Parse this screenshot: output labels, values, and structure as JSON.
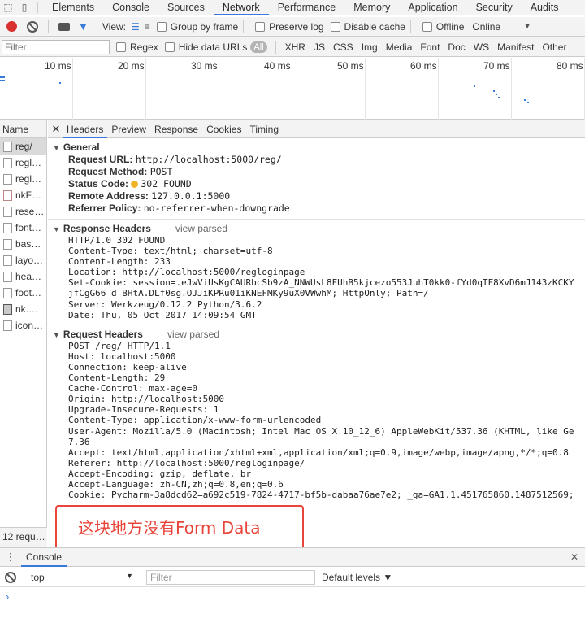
{
  "main_tabs": [
    "Elements",
    "Console",
    "Sources",
    "Network",
    "Performance",
    "Memory",
    "Application",
    "Security",
    "Audits"
  ],
  "active_tab": "Network",
  "toolbar": {
    "view_label": "View:",
    "group_by_frame": "Group by frame",
    "preserve_log": "Preserve log",
    "disable_cache": "Disable cache",
    "offline": "Offline",
    "throttle": "Online"
  },
  "filter": {
    "placeholder": "Filter",
    "regex": "Regex",
    "hide_data_urls": "Hide data URLs",
    "all": "All",
    "types": [
      "XHR",
      "JS",
      "CSS",
      "Img",
      "Media",
      "Font",
      "Doc",
      "WS",
      "Manifest",
      "Other"
    ]
  },
  "timeline_ticks": [
    "10 ms",
    "20 ms",
    "30 ms",
    "40 ms",
    "50 ms",
    "60 ms",
    "70 ms",
    "80 ms"
  ],
  "name_column": {
    "header": "Name",
    "items": [
      {
        "name": "reg/",
        "kind": "doc"
      },
      {
        "name": "regl…",
        "kind": "doc"
      },
      {
        "name": "regl…",
        "kind": "doc"
      },
      {
        "name": "nkF…",
        "kind": "font"
      },
      {
        "name": "rese…",
        "kind": "doc"
      },
      {
        "name": "font…",
        "kind": "doc"
      },
      {
        "name": "bas…",
        "kind": "doc"
      },
      {
        "name": "layo…",
        "kind": "doc"
      },
      {
        "name": "hea…",
        "kind": "doc"
      },
      {
        "name": "foot…",
        "kind": "doc"
      },
      {
        "name": "nk.…",
        "kind": "img"
      },
      {
        "name": "icon…",
        "kind": "doc"
      }
    ],
    "footer": "12 requ…"
  },
  "detail_tabs": [
    "Headers",
    "Preview",
    "Response",
    "Cookies",
    "Timing"
  ],
  "general": {
    "title": "General",
    "rows": [
      {
        "k": "Request URL:",
        "v": "http://localhost:5000/reg/"
      },
      {
        "k": "Request Method:",
        "v": "POST"
      },
      {
        "k": "Status Code:",
        "v": "302 FOUND"
      },
      {
        "k": "Remote Address:",
        "v": "127.0.0.1:5000"
      },
      {
        "k": "Referrer Policy:",
        "v": "no-referrer-when-downgrade"
      }
    ]
  },
  "response_headers": {
    "title": "Response Headers",
    "view_parsed": "view parsed",
    "lines": [
      "HTTP/1.0 302 FOUND",
      "Content-Type: text/html; charset=utf-8",
      "Content-Length: 233",
      "Location: http://localhost:5000/regloginpage",
      "Set-Cookie: session=.eJwViUsKgCAURbcSb9zA_NNWUsL8FUhB5kjcezo553JuhT0kk0-fYd0qTF8XvD6mJ143zKCKY",
      "jfCgG66_d_BHtA.DLf0sg.OJJiKPRu01iKNEFMKy9uX0VWwhM; HttpOnly; Path=/",
      "Server: Werkzeug/0.12.2 Python/3.6.2",
      "Date: Thu, 05 Oct 2017 14:09:54 GMT"
    ]
  },
  "request_headers": {
    "title": "Request Headers",
    "view_parsed": "view parsed",
    "lines": [
      "POST /reg/ HTTP/1.1",
      "Host: localhost:5000",
      "Connection: keep-alive",
      "Content-Length: 29",
      "Cache-Control: max-age=0",
      "Origin: http://localhost:5000",
      "Upgrade-Insecure-Requests: 1",
      "Content-Type: application/x-www-form-urlencoded",
      "User-Agent: Mozilla/5.0 (Macintosh; Intel Mac OS X 10_12_6) AppleWebKit/537.36 (KHTML, like Ge",
      "7.36",
      "Accept: text/html,application/xhtml+xml,application/xml;q=0.9,image/webp,image/apng,*/*;q=0.8",
      "Referer: http://localhost:5000/regloginpage/",
      "Accept-Encoding: gzip, deflate, br",
      "Accept-Language: zh-CN,zh;q=0.8,en;q=0.6",
      "Cookie: Pycharm-3a8dcd62=a692c519-7824-4717-bf5b-dabaa76ae7e2; _ga=GA1.1.451765860.1487512569;"
    ]
  },
  "annotation": "这块地方没有Form Data",
  "drawer": {
    "tab": "Console",
    "context": "top",
    "filter_placeholder": "Filter",
    "levels": "Default levels ▼",
    "prompt": "›"
  }
}
